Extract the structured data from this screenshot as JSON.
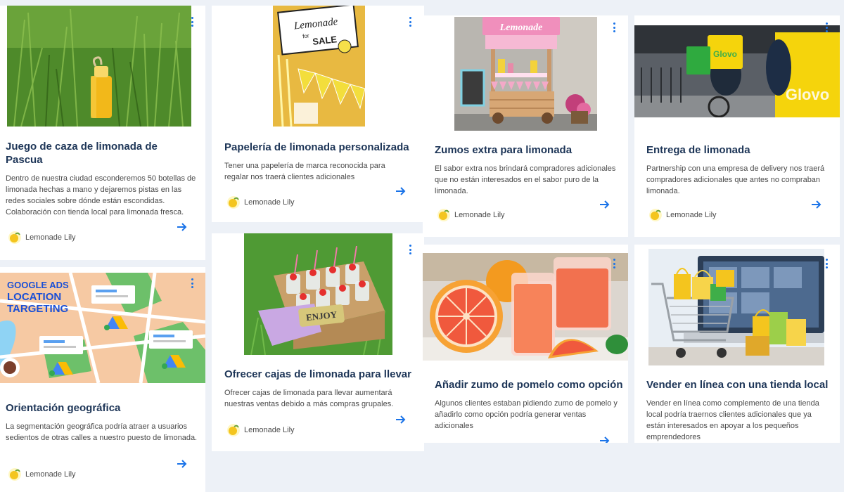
{
  "author_name": "Lemonade Lily",
  "cards": [
    {
      "title": "Juego de caza de limonada de Pascua",
      "description": "Dentro de nuestra ciudad esconderemos 50 botellas de limonada hechas a mano y dejaremos pistas en las redes sociales sobre dónde están escondidas. Colaboración con tienda local para limonada fresca."
    },
    {
      "title": "Papelería de limonada personalizada",
      "description": "Tener una papelería de marca reconocida para regalar nos traerá clientes adicionales",
      "image_text": {
        "line1": "Lemonade",
        "line2": "for",
        "line3": "SALE"
      }
    },
    {
      "title": "Zumos extra para limonada",
      "description": "El sabor extra nos brindará compradores adicionales que no están interesados en el sabor puro de la limonada.",
      "image_text": {
        "sign": "Lemonade"
      }
    },
    {
      "title": "Entrega de limonada",
      "description": "Partnership con una empresa de delivery nos traerá compradores adicionales que antes no compraban limonada.",
      "image_text": {
        "brand": "Glovo"
      }
    },
    {
      "title": "Orientación geográfica",
      "description": "La segmentación geográfica podría atraer a usuarios sedientos de otras calles a nuestro puesto de limonada.",
      "image_text": {
        "line1": "GOOGLE ADS",
        "line2": "LOCATION",
        "line3": "TARGETING"
      }
    },
    {
      "title": "Ofrecer cajas de limonada para llevar",
      "description": "Ofrecer cajas de limonada para llevar aumentará nuestras ventas debido a más compras grupales.",
      "image_text": {
        "crate": "ENJOY"
      }
    },
    {
      "title": "Añadir zumo de pomelo como opción",
      "description": "Algunos clientes estaban pidiendo zumo de pomelo y añadirlo como opción podría generar ventas adicionales"
    },
    {
      "title": "Vender en línea con una tienda local",
      "description": "Vender en línea como complemento de una tienda local podría traernos clientes adicionales que ya están interesados en apoyar a los pequeños emprendedores"
    }
  ]
}
